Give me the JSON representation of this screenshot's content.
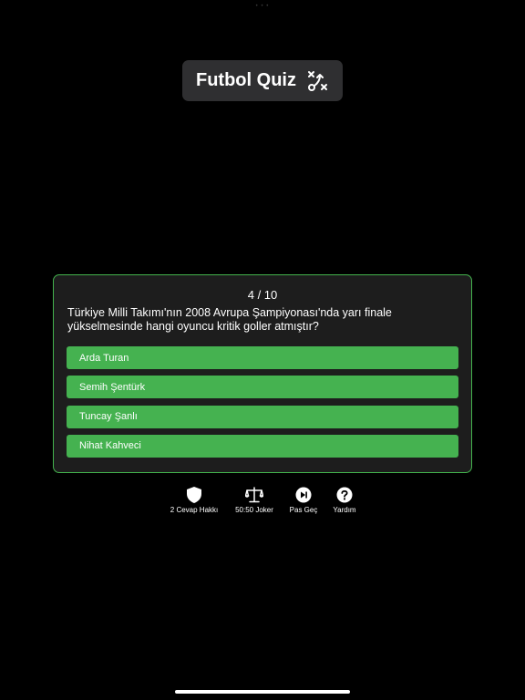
{
  "app": {
    "title": "Futbol Quiz",
    "title_icon": "tactics-icon"
  },
  "quiz": {
    "counter": "4 / 10",
    "question": "Türkiye Milli Takımı'nın 2008 Avrupa Şampiyonası'nda yarı finale yükselmesinde hangi oyuncu kritik goller atmıştır?",
    "answers": [
      "Arda Turan",
      "Semih Şentürk",
      "Tuncay Şanlı",
      "Nihat Kahveci"
    ]
  },
  "lifelines": [
    {
      "label": "2 Cevap Hakkı",
      "icon": "shield-icon"
    },
    {
      "label": "50:50 Joker",
      "icon": "scale-icon"
    },
    {
      "label": "Pas Geç",
      "icon": "skip-icon"
    },
    {
      "label": "Yardım",
      "icon": "help-icon"
    }
  ],
  "colors": {
    "accent": "#45b250",
    "card_border": "#43b34d",
    "card_bg": "#1d1d1d",
    "pill_bg": "#2f2f31",
    "background": "#000000"
  }
}
